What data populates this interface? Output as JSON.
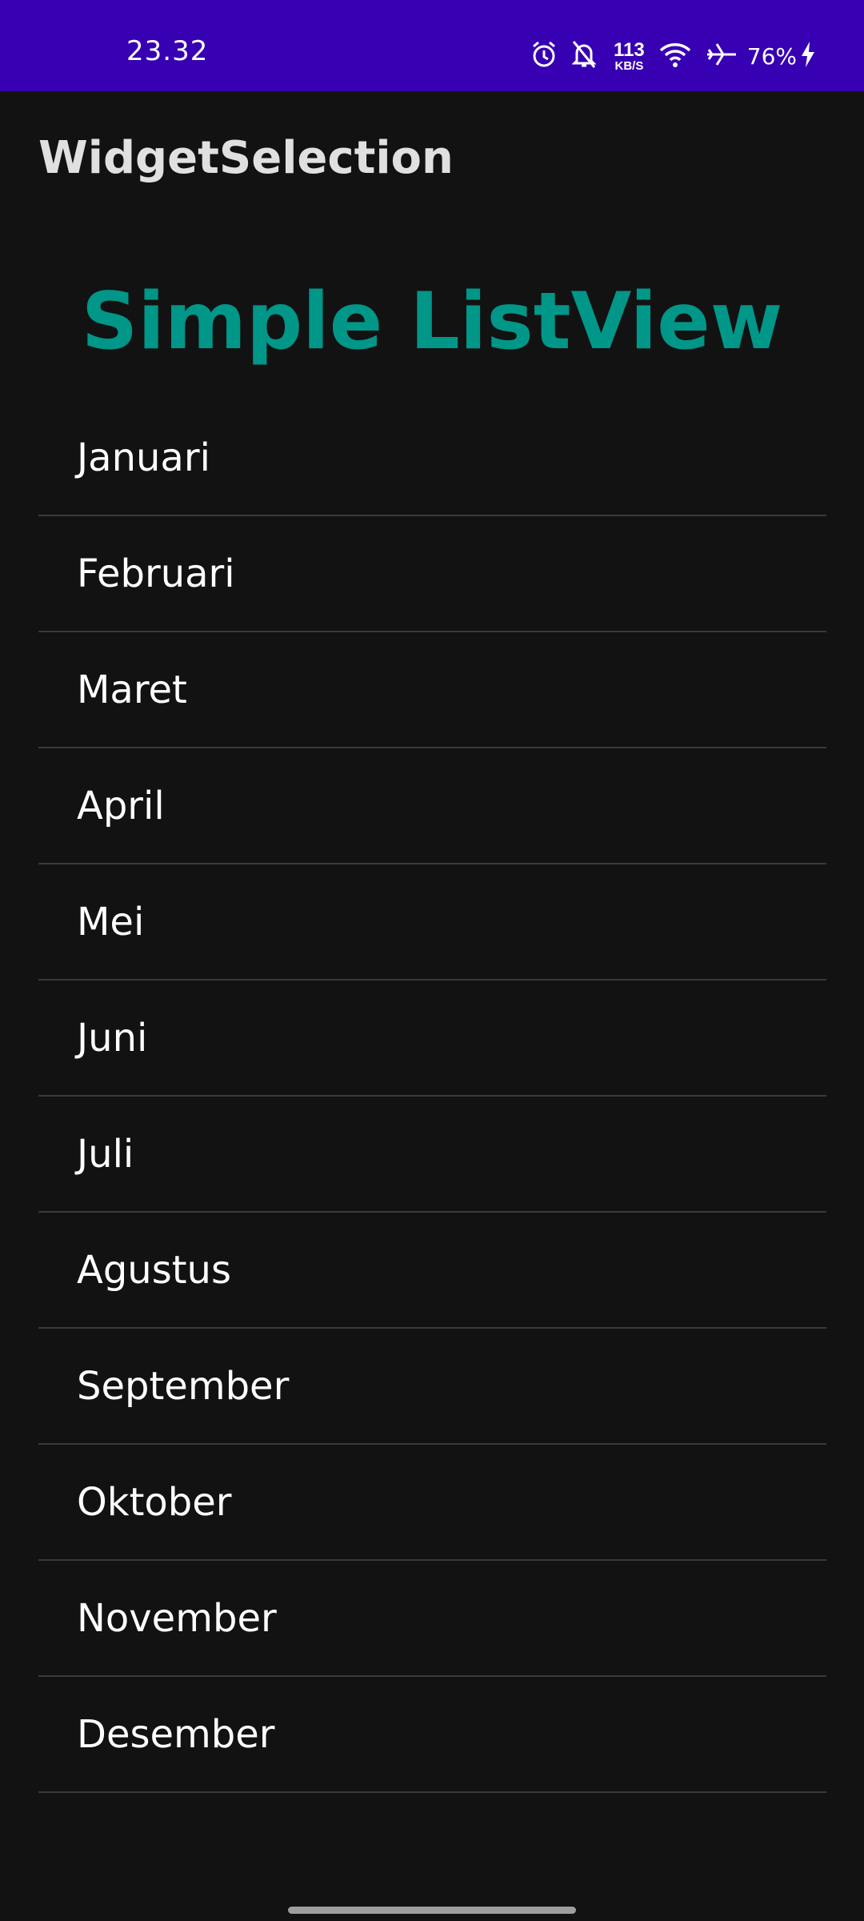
{
  "status_bar": {
    "time": "23.32",
    "net_speed_value": "113",
    "net_speed_unit": "KB/S",
    "battery": "76%",
    "icons": [
      "alarm-icon",
      "bell-off-icon",
      "wifi-icon",
      "airplane-icon",
      "charging-icon"
    ],
    "background": "#3700b3"
  },
  "app_bar": {
    "title": "WidgetSelection"
  },
  "heading": {
    "text": "Simple ListView",
    "color": "#009688"
  },
  "list": {
    "items": [
      "Januari",
      "Februari",
      "Maret",
      "April",
      "Mei",
      "Juni",
      "Juli",
      "Agustus",
      "September",
      "Oktober",
      "November",
      "Desember"
    ]
  }
}
